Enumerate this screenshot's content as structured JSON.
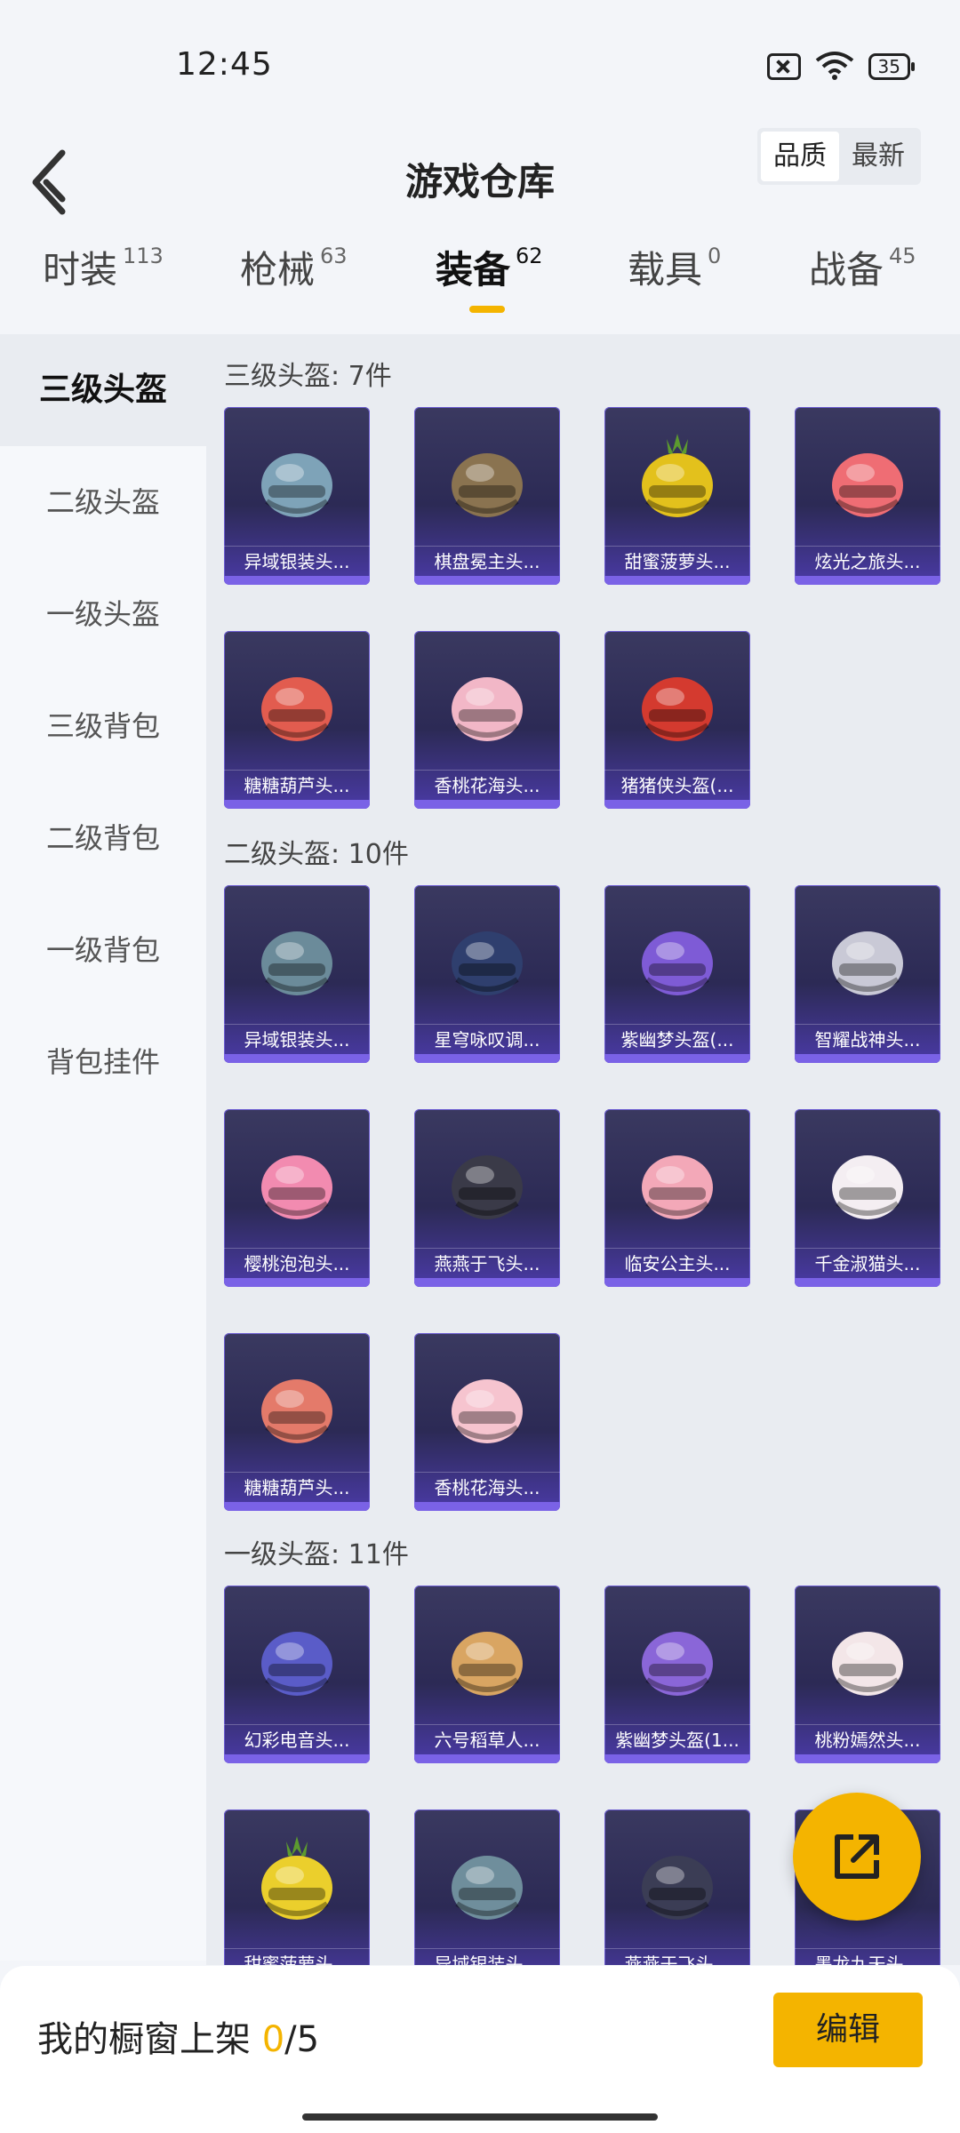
{
  "status_bar": {
    "time": "12:45",
    "battery": "35"
  },
  "header": {
    "title": "游戏仓库",
    "sort_options": [
      "品质",
      "最新"
    ]
  },
  "tabs": [
    {
      "label": "时装",
      "count": "113"
    },
    {
      "label": "枪械",
      "count": "63"
    },
    {
      "label": "装备",
      "count": "62"
    },
    {
      "label": "载具",
      "count": "0"
    },
    {
      "label": "战备",
      "count": "45"
    }
  ],
  "sidebar": {
    "items": [
      "三级头盔",
      "二级头盔",
      "一级头盔",
      "三级背包",
      "二级背包",
      "一级背包",
      "背包挂件"
    ]
  },
  "sections": [
    {
      "title": "三级头盔: 7件",
      "items": [
        {
          "name": "异域银装头...",
          "color": "#7ea3b8",
          "icon": "helmet-icon"
        },
        {
          "name": "棋盘冕主头...",
          "color": "#8a7350",
          "icon": "helmet-icon"
        },
        {
          "name": "甜蜜菠萝头...",
          "color": "#e3c11c",
          "icon": "pineapple-helmet-icon"
        },
        {
          "name": "炫光之旅头...",
          "color": "#ef6d74",
          "icon": "helmet-icon"
        },
        {
          "name": "糖糖葫芦头...",
          "color": "#e25c4f",
          "icon": "helmet-icon"
        },
        {
          "name": "香桃花海头...",
          "color": "#f2b7c7",
          "icon": "helmet-icon"
        },
        {
          "name": "猪猪侠头盔(...",
          "color": "#d43a2f",
          "icon": "helmet-icon"
        }
      ]
    },
    {
      "title": "二级头盔: 10件",
      "items": [
        {
          "name": "异域银装头...",
          "color": "#6b8b9a",
          "icon": "helmet-icon"
        },
        {
          "name": "星穹咏叹调...",
          "color": "#2f3f6e",
          "icon": "helmet-icon"
        },
        {
          "name": "紫幽梦头盔(...",
          "color": "#7e5bd6",
          "icon": "helmet-icon"
        },
        {
          "name": "智耀战神头...",
          "color": "#c9c9d6",
          "icon": "helmet-icon"
        },
        {
          "name": "樱桃泡泡头...",
          "color": "#f28bb0",
          "icon": "helmet-icon"
        },
        {
          "name": "燕燕于飞头...",
          "color": "#3a3a48",
          "icon": "helmet-icon"
        },
        {
          "name": "临安公主头...",
          "color": "#f3a8b8",
          "icon": "helmet-icon"
        },
        {
          "name": "千金淑猫头...",
          "color": "#f4eef2",
          "icon": "helmet-icon"
        },
        {
          "name": "糖糖葫芦头...",
          "color": "#e47a6a",
          "icon": "helmet-icon"
        },
        {
          "name": "香桃花海头...",
          "color": "#f6c4cf",
          "icon": "helmet-icon"
        }
      ]
    },
    {
      "title": "一级头盔: 11件",
      "items": [
        {
          "name": "幻彩电音头...",
          "color": "#5a5cc8",
          "icon": "helmet-icon"
        },
        {
          "name": "六号稻草人...",
          "color": "#d9a562",
          "icon": "helmet-icon"
        },
        {
          "name": "紫幽梦头盔(1...",
          "color": "#8a66d8",
          "icon": "helmet-icon"
        },
        {
          "name": "桃粉嫣然头...",
          "color": "#f3e6e8",
          "icon": "helmet-icon"
        },
        {
          "name": "甜蜜菠萝头...",
          "color": "#ebcf2c",
          "icon": "pineapple-helmet-icon"
        },
        {
          "name": "异域银装头...",
          "color": "#6f8e9c",
          "icon": "helmet-icon"
        },
        {
          "name": "燕燕于飞头...",
          "color": "#3b3d55",
          "icon": "helmet-icon"
        },
        {
          "name": "墨龙九天头...",
          "color": "#2e2e3c",
          "icon": "helmet-icon"
        }
      ]
    }
  ],
  "footer": {
    "showcase_label": "我的橱窗上架 ",
    "showcase_count": "0",
    "showcase_total": "/5",
    "edit_label": "编辑"
  }
}
